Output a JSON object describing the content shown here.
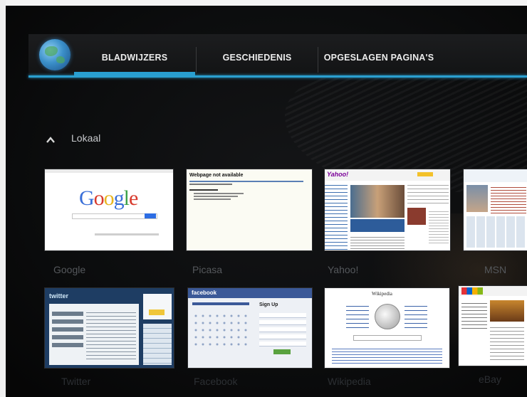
{
  "tabs": [
    {
      "label": "BLADWIJZERS",
      "active": true
    },
    {
      "label": "GESCHIEDENIS",
      "active": false
    },
    {
      "label": "OPGESLAGEN PAGINA'S",
      "active": false
    }
  ],
  "section": {
    "label": "Lokaal",
    "expanded": true
  },
  "bookmarks": [
    {
      "label": "Google"
    },
    {
      "label": "Picasa"
    },
    {
      "label": "Yahoo!"
    },
    {
      "label": "MSN"
    },
    {
      "label": "Twitter"
    },
    {
      "label": "Facebook"
    },
    {
      "label": "Wikipedia"
    },
    {
      "label": "eBay"
    }
  ],
  "thumbs": {
    "google_logo": "Google",
    "picasa_title": "Webpage not available",
    "yahoo_logo": "Yahoo!",
    "twitter_logo": "twitter",
    "facebook_logo": "facebook",
    "facebook_signup": "Sign Up",
    "wikipedia_logo": "Wikipedia"
  },
  "colors": {
    "accent": "#2a9fd0",
    "actionbar": "#1a1b1d",
    "background": "#0c0d0e",
    "label": "#55585c"
  },
  "icons": {
    "app_icon": "globe-icon",
    "section_toggle": "chevron-up-icon"
  }
}
